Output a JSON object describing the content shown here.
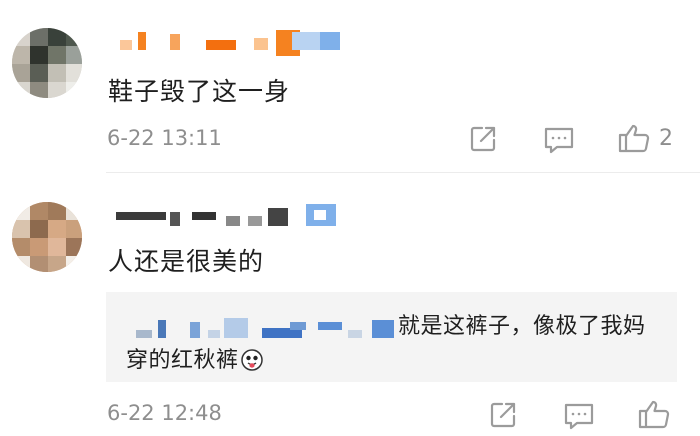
{
  "comments": [
    {
      "text": "鞋子毁了这一身",
      "time": "6-22 13:11",
      "like_count": "2",
      "actions": {
        "share_icon": "share-icon",
        "reply_icon": "comment-icon",
        "like_icon": "thumbs-up-icon"
      }
    },
    {
      "text": "人还是很美的",
      "time": "6-22 12:48",
      "like_count": "",
      "reply": {
        "text": "就是这裤子，像极了我妈穿的红秋裤",
        "emoji": "tongue-emoji"
      },
      "actions": {
        "share_icon": "share-icon",
        "reply_icon": "comment-icon",
        "like_icon": "thumbs-up-icon"
      }
    }
  ],
  "colors": {
    "text": "#1f1f1f",
    "meta": "#8e8e8e",
    "reply_bg": "#f4f4f4",
    "username_orange": "#f58220",
    "username_blue": "#5b8fd6"
  }
}
